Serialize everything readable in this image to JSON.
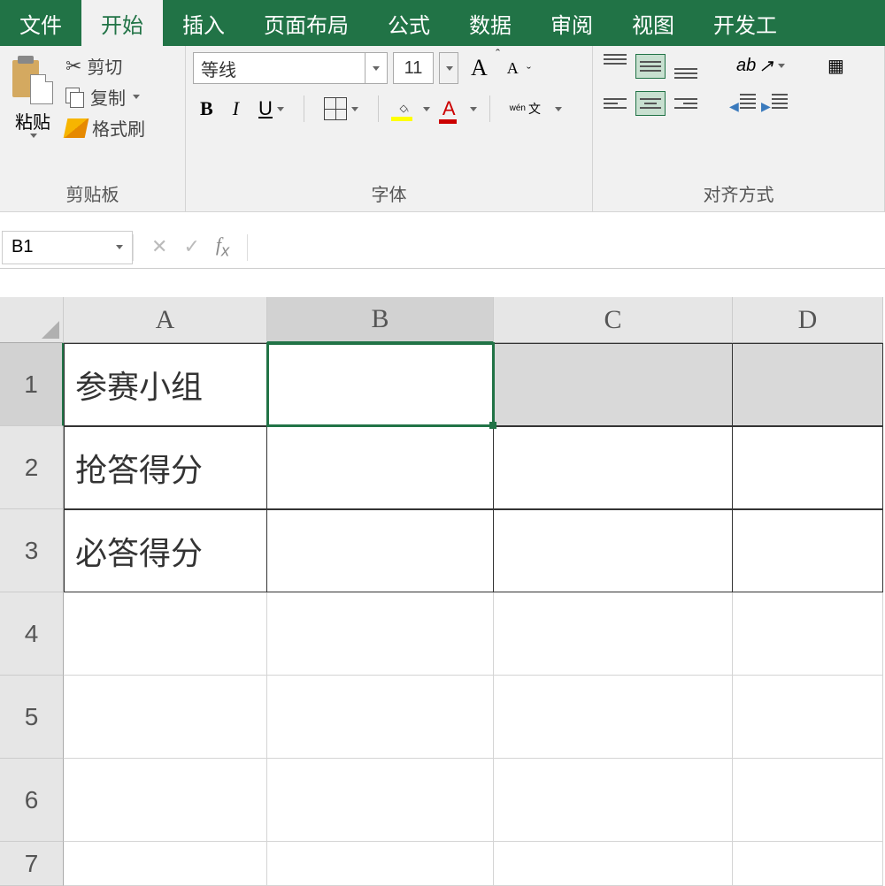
{
  "tabs": [
    "文件",
    "开始",
    "插入",
    "页面布局",
    "公式",
    "数据",
    "审阅",
    "视图",
    "开发工"
  ],
  "active_tab": 1,
  "clipboard": {
    "paste": "粘贴",
    "cut": "剪切",
    "copy": "复制",
    "format_painter": "格式刷",
    "group": "剪贴板"
  },
  "font": {
    "name": "等线",
    "size": "11",
    "bold": "B",
    "italic": "I",
    "underline": "U",
    "font_color_letter": "A",
    "wen_top": "wén",
    "wen": "文",
    "group": "字体"
  },
  "alignment": {
    "orient": "ab",
    "group": "对齐方式"
  },
  "name_box": "B1",
  "columns": [
    "A",
    "B",
    "C",
    "D"
  ],
  "col_widths": [
    "col-A",
    "col-B",
    "col-C",
    "col-D"
  ],
  "rows": [
    "1",
    "2",
    "3",
    "4",
    "5",
    "6",
    "7"
  ],
  "data": {
    "A1": "参赛小组",
    "A2": "抢答得分",
    "A3": "必答得分"
  },
  "selected_cell": "B1"
}
